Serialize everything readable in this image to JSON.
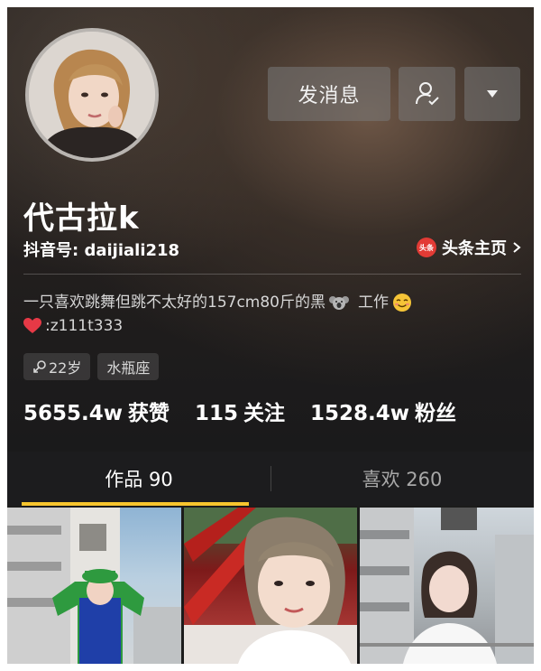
{
  "profile": {
    "name": "代古拉k",
    "douyin_id": "抖音号: daijiali218",
    "toutiao_link": "头条主页",
    "toutiao_badge": "头条",
    "bio_line1": "一只喜欢跳舞但跳不太好的157cm80斤的黑",
    "bio_work": "工作",
    "bio_contact": ":z111t333",
    "tags": {
      "age": "22岁",
      "zodiac": "水瓶座"
    }
  },
  "actions": {
    "message_label": "发消息",
    "follow_icon": "user-check-icon",
    "more_icon": "caret-down-icon"
  },
  "stats": {
    "likes_value": "5655.4w",
    "likes_label": "获赞",
    "following_value": "115",
    "following_label": "关注",
    "followers_value": "1528.4w",
    "followers_label": "粉丝"
  },
  "tabs": {
    "works": "作品 90",
    "likes": "喜欢 260"
  },
  "colors": {
    "accent": "#f7c52e",
    "toutiao_red": "#e23b35",
    "heart": "#e63946"
  }
}
